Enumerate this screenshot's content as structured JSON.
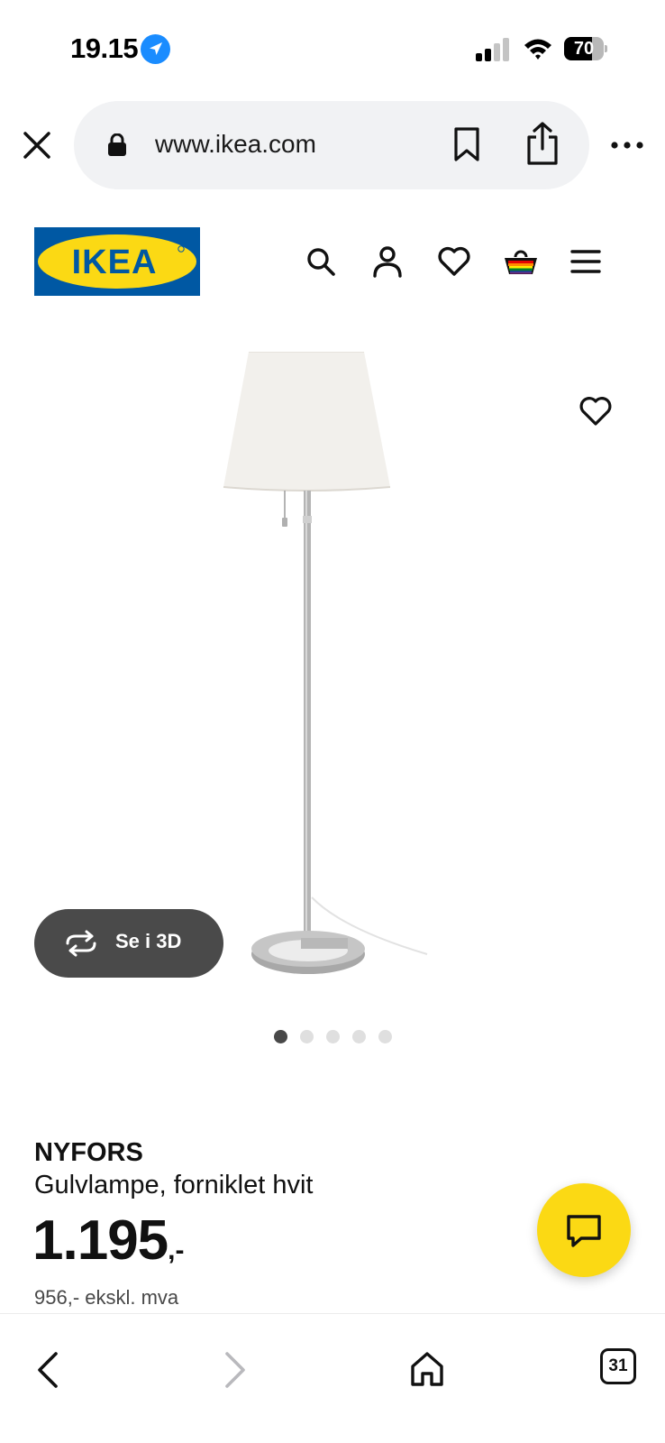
{
  "status_bar": {
    "time": "19.15",
    "battery_level": "70",
    "icons": [
      "location-arrow-icon",
      "signal-icon",
      "wifi-icon",
      "battery-icon"
    ]
  },
  "browser": {
    "url": "www.ikea.com",
    "icons": [
      "close-icon",
      "lock-icon",
      "bookmark-icon",
      "share-icon",
      "more-icon"
    ]
  },
  "header": {
    "logo_text": "IKEA",
    "icons": [
      "search-icon",
      "account-icon",
      "heart-icon",
      "basket-icon",
      "menu-icon"
    ]
  },
  "product": {
    "view_3d_label": "Se i 3D",
    "image_count": 5,
    "active_image": 1,
    "name": "NYFORS",
    "description": "Gulvlampe, forniklet hvit",
    "price_main": "1.195",
    "price_suffix": ",-",
    "price_ex_vat": "956,- ekskl. mva"
  },
  "bottom_toolbar": {
    "tabs_count": "31",
    "icons": [
      "back-icon",
      "forward-icon",
      "home-icon",
      "tabs-icon"
    ]
  },
  "colors": {
    "ikea_blue": "#0058a3",
    "ikea_yellow": "#fbd914",
    "pill_bg": "#f1f2f4",
    "button_3d_bg": "#4a4a4a",
    "location_blue": "#1a8cff"
  }
}
